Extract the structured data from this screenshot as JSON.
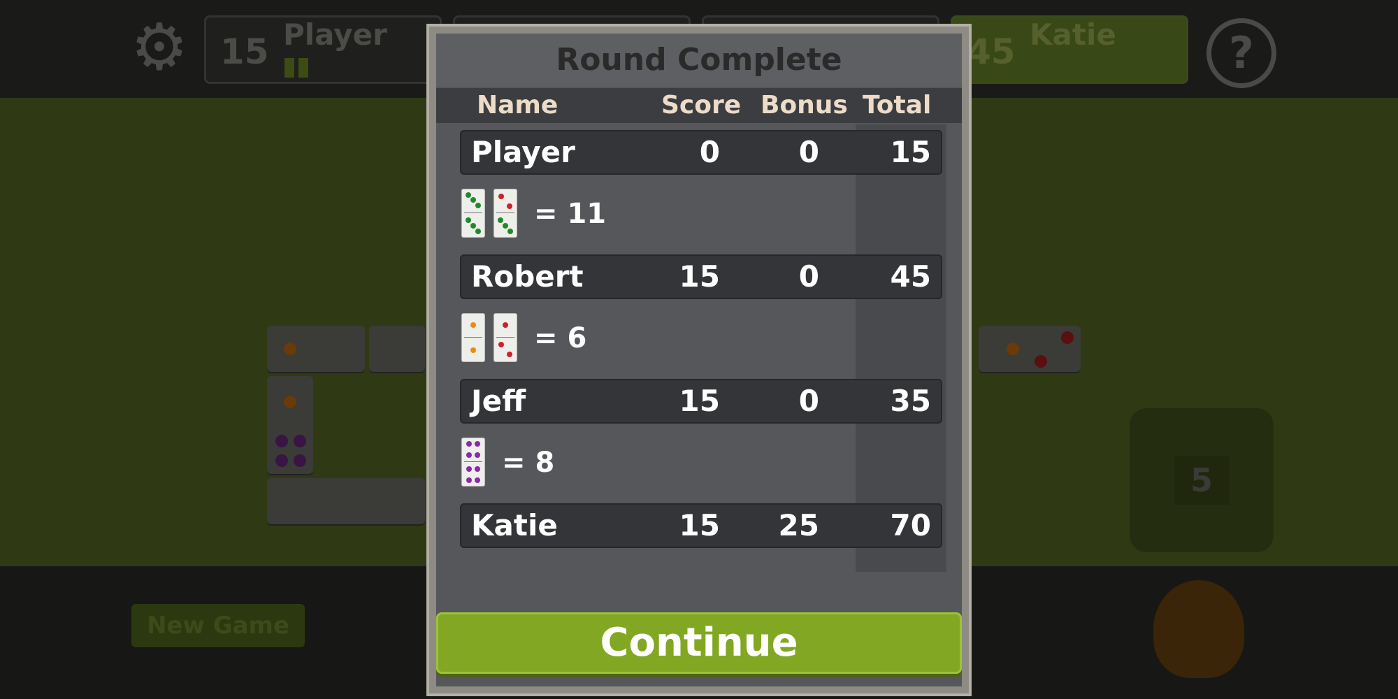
{
  "top_bar": {
    "players": [
      {
        "name": "Player",
        "score": "15"
      },
      {
        "name": "Robert",
        "score": ""
      },
      {
        "name": "Jeff",
        "score": ""
      },
      {
        "name": "Katie",
        "score": "45"
      }
    ]
  },
  "icons": {
    "settings": "gear-icon",
    "help": "help-icon",
    "boneyard": "sack-icon"
  },
  "board": {
    "boneyard_count": "5"
  },
  "buttons": {
    "new_game": "New Game",
    "continue": "Continue"
  },
  "dialog": {
    "title": "Round Complete",
    "columns": {
      "name": "Name",
      "score": "Score",
      "bonus": "Bonus",
      "total": "Total"
    },
    "rows": [
      {
        "name": "Player",
        "score": "0",
        "bonus": "0",
        "total": "15",
        "hand_total": "= 11"
      },
      {
        "name": "Robert",
        "score": "15",
        "bonus": "0",
        "total": "45",
        "hand_total": "= 6"
      },
      {
        "name": "Jeff",
        "score": "15",
        "bonus": "0",
        "total": "35",
        "hand_total": "= 8"
      },
      {
        "name": "Katie",
        "score": "15",
        "bonus": "25",
        "total": "70"
      }
    ]
  },
  "colors": {
    "accent": "#82a723",
    "dialog_bg": "#56575a",
    "felt": "#2f3a14"
  }
}
